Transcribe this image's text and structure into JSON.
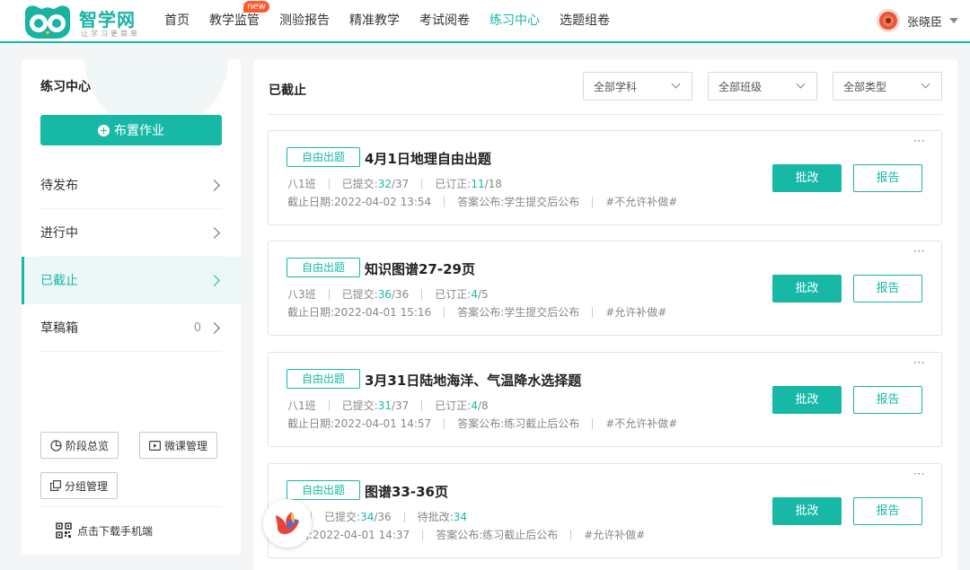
{
  "brand": {
    "name": "智学网",
    "slogan": "让学习更简单",
    "accent": "#17b8a6"
  },
  "nav": {
    "items": [
      {
        "label": "首页",
        "active": false
      },
      {
        "label": "教学监管",
        "active": false,
        "badge": "new"
      },
      {
        "label": "测验报告",
        "active": false
      },
      {
        "label": "精准教学",
        "active": false
      },
      {
        "label": "考试阅卷",
        "active": false
      },
      {
        "label": "练习中心",
        "active": true
      },
      {
        "label": "选题组卷",
        "active": false
      }
    ],
    "user": {
      "name": "张晓臣"
    }
  },
  "sidebar": {
    "title": "练习中心",
    "assign_label": "布置作业",
    "menu": [
      {
        "label": "待发布",
        "count": ""
      },
      {
        "label": "进行中",
        "count": ""
      },
      {
        "label": "已截止",
        "count": "",
        "active": true
      },
      {
        "label": "草稿箱",
        "count": "0"
      }
    ],
    "tools": {
      "stage": "阶段总览",
      "micro": "微课管理",
      "group": "分组管理"
    },
    "download": "点击下载手机端"
  },
  "main": {
    "title": "已截止",
    "filters": [
      "全部学科",
      "全部班级",
      "全部类型"
    ],
    "cards": [
      {
        "tag": "自由出题",
        "title": "4月1日地理自由出题",
        "class": "八1班",
        "submitted_label": "已提交:",
        "submitted": "32",
        "submitted_total": "/37",
        "third_label": "已订正:",
        "third": "11",
        "third_total": "/18",
        "deadline": "截止日期:2022-04-02 13:54",
        "answer": "答案公布:学生提交后公布",
        "makeup": "#不允许补做#",
        "grade_label": "批改",
        "report_label": "报告",
        "more": "···"
      },
      {
        "tag": "自由出题",
        "title": "知识图谱27-29页",
        "class": "八3班",
        "submitted_label": "已提交:",
        "submitted": "36",
        "submitted_total": "/36",
        "third_label": "已订正:",
        "third": "4",
        "third_total": "/5",
        "deadline": "截止日期:2022-04-01 15:16",
        "answer": "答案公布:学生提交后公布",
        "makeup": "#允许补做#",
        "grade_label": "批改",
        "report_label": "报告",
        "more": "···"
      },
      {
        "tag": "自由出题",
        "title": "3月31日陆地海洋、气温降水选择题",
        "class": "八1班",
        "submitted_label": "已提交:",
        "submitted": "31",
        "submitted_total": "/37",
        "third_label": "已订正:",
        "third": "4",
        "third_total": "/8",
        "deadline": "截止日期:2022-04-01 14:57",
        "answer": "答案公布:练习截止后公布",
        "makeup": "#不允许补做#",
        "grade_label": "批改",
        "report_label": "报告",
        "more": "···"
      },
      {
        "tag": "自由出题",
        "title": "图谱33-36页",
        "class": "班",
        "submitted_label": "已提交:",
        "submitted": "34",
        "submitted_total": "/36",
        "third_label": "待批改:",
        "third": "34",
        "third_total": "",
        "deadline": "日期:2022-04-01 14:37",
        "answer": "答案公布:练习截止后公布",
        "makeup": "#允许补做#",
        "grade_label": "批改",
        "report_label": "报告",
        "more": "···"
      }
    ]
  }
}
